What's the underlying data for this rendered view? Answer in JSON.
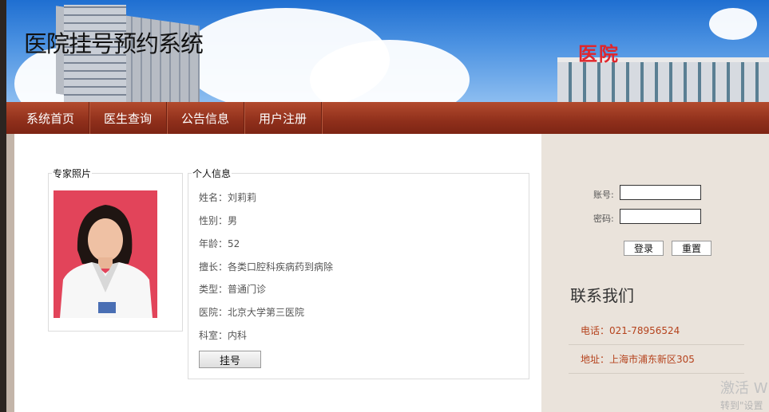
{
  "banner": {
    "title": "医院挂号预约系统",
    "hospital_sign": "医院"
  },
  "nav": {
    "items": [
      {
        "label": "系统首页"
      },
      {
        "label": "医生查询"
      },
      {
        "label": "公告信息"
      },
      {
        "label": "用户注册"
      }
    ]
  },
  "photo_box": {
    "legend": "专家照片"
  },
  "info_box": {
    "legend": "个人信息",
    "rows": [
      {
        "label": "姓名：",
        "value": "刘莉莉"
      },
      {
        "label": "性别：",
        "value": "男"
      },
      {
        "label": "年龄：",
        "value": "52"
      },
      {
        "label": "擅长：",
        "value": "各类口腔科疾病药到病除"
      },
      {
        "label": "类型：",
        "value": "普通门诊"
      },
      {
        "label": "医院：",
        "value": "北京大学第三医院"
      },
      {
        "label": "科室：",
        "value": "内科"
      }
    ],
    "book_button": "挂号"
  },
  "login": {
    "account_label": "账号:",
    "password_label": "密码:",
    "account_value": "",
    "password_value": "",
    "login_button": "登录",
    "reset_button": "重置"
  },
  "contact": {
    "title": "联系我们",
    "phone": "电话：021-78956524",
    "address": "地址：上海市浦东新区305"
  },
  "watermark": {
    "line1": "激活 W",
    "line2": "转到\"设置"
  }
}
